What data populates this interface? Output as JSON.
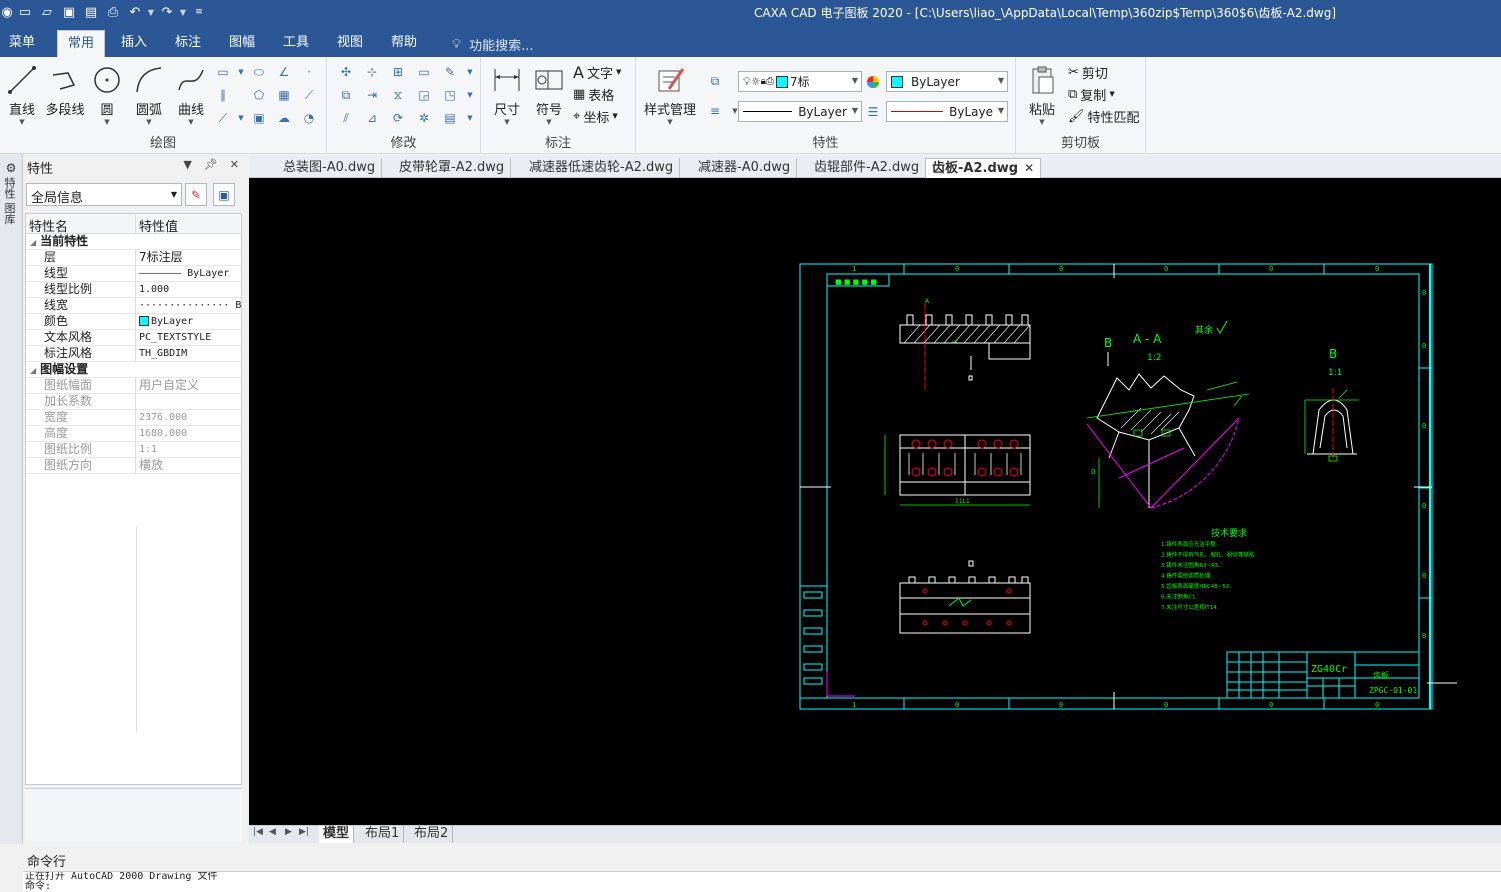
{
  "window": {
    "title": "CAXA CAD 电子图板 2020 - [C:\\Users\\liao_\\AppData\\Local\\Temp\\360zip$Temp\\360$6\\齿板-A2.dwg]"
  },
  "quick_access": {
    "icons": [
      "app-icon",
      "new-file-icon",
      "open-file-icon",
      "save-icon",
      "save-as-icon",
      "print-icon",
      "undo-icon",
      "redo-icon",
      "customize-icon"
    ]
  },
  "menu_tabs": [
    "菜单",
    "常用",
    "插入",
    "标注",
    "图幅",
    "工具",
    "视图",
    "帮助"
  ],
  "active_menu_tab": "常用",
  "search": {
    "placeholder": "功能搜索..."
  },
  "ribbon": {
    "draw": {
      "label": "绘图",
      "buttons": [
        "直线",
        "多段线",
        "圆",
        "圆弧",
        "曲线"
      ]
    },
    "modify": {
      "label": "修改"
    },
    "annotate": {
      "label": "标注",
      "dimension": "尺寸",
      "symbol": "符号",
      "text": "文字",
      "table": "表格",
      "coordinate": "坐标"
    },
    "properties": {
      "label": "特性",
      "style_manager": "样式管理",
      "layer": "7标",
      "color": "ByLayer",
      "linetype": "ByLayer",
      "lineweight": "ByLaye"
    },
    "clipboard": {
      "label": "剪切板",
      "paste": "粘贴",
      "cut": "剪切",
      "copy": "复制",
      "match": "特性匹配"
    }
  },
  "side_strip": {
    "tab_label": "特性 图库"
  },
  "properties_panel": {
    "title": "特性",
    "scope": "全局信息",
    "columns": [
      "特性名",
      "特性值"
    ],
    "current": {
      "category": "当前特性",
      "rows": [
        {
          "name": "层",
          "value": "7标注层",
          "cjk": true
        },
        {
          "name": "线型",
          "value": "——————— ByLayer",
          "cjk": false
        },
        {
          "name": "线型比例",
          "value": "1.000",
          "cjk": false
        },
        {
          "name": "线宽",
          "value": "··············· ByLayer",
          "cjk": false
        },
        {
          "name": "颜色",
          "value": "ByLayer",
          "cjk": false,
          "swatch": "#00ffff"
        },
        {
          "name": "文本风格",
          "value": "PC_TEXTSTYLE",
          "cjk": false
        },
        {
          "name": "标注风格",
          "value": "TH_GBDIM",
          "cjk": false
        }
      ]
    },
    "sheet": {
      "category": "图幅设置",
      "rows": [
        {
          "name": "图纸幅面",
          "value": "用户自定义",
          "cjk": true
        },
        {
          "name": "加长系数",
          "value": "",
          "cjk": false
        },
        {
          "name": "宽度",
          "value": "2376.000",
          "cjk": false
        },
        {
          "name": "高度",
          "value": "1680.000",
          "cjk": false
        },
        {
          "name": "图纸比例",
          "value": "1:1",
          "cjk": false
        },
        {
          "name": "图纸方向",
          "value": "横放",
          "cjk": true
        }
      ]
    }
  },
  "doc_tabs": [
    "总装图-A0.dwg",
    "皮带轮罩-A2.dwg",
    "减速器低速齿轮-A2.dwg",
    "减速器-A0.dwg",
    "齿辊部件-A2.dwg",
    "齿板-A2.dwg"
  ],
  "active_doc_tab": "齿板-A2.dwg",
  "drawing": {
    "view_aa": "A - A",
    "view_aa_scale": "1:2",
    "view_b": "B",
    "view_b_scale": "1:1",
    "section_mark_b": "B",
    "roughness_note": "其余",
    "tech_title": "技术要求",
    "tech_notes": [
      "1.铸件表面应光洁平整.",
      "2.铸件不得有气孔、缩孔、裂纹等缺陷.",
      "3.铸件未注圆角R3~R5.",
      "4.铸件需经调质处理.",
      "5.齿板表面硬度HRC48~52.",
      "6.未注倒角C1.",
      "7.未注尺寸公差按IT14."
    ],
    "material": "ZG40Cr",
    "part_name": "齿板",
    "drawing_no": "ZPGC-01-01",
    "colors": {
      "frame": "#00ffff",
      "geometry": "#ffffff",
      "annotation": "#00ff00",
      "center": "#ff0000",
      "arc": "#ff00ff"
    }
  },
  "layout_tabs": [
    "模型",
    "布局1",
    "布局2"
  ],
  "active_layout_tab": "模型",
  "command": {
    "title": "命令行",
    "lines": [
      "正在打开 AutoCAD 2000 Drawing 文件",
      "命令:"
    ]
  }
}
